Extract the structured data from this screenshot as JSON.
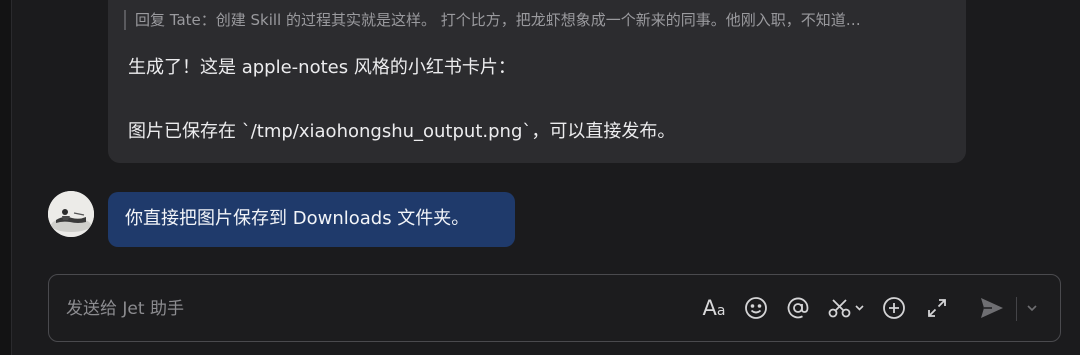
{
  "conversation": {
    "bot_message": {
      "quote": "回复 Tate：创建 Skill 的过程其实就是这样。 打个比方，把龙虾想象成一个新来的同事。他刚入职，不知道…",
      "line1": "生成了！这是 apple-notes 风格的小红书卡片：",
      "line2": "图片已保存在 `/tmp/xiaohongshu_output.png`，可以直接发布。"
    },
    "user_message": {
      "text": "你直接把图片保存到 Downloads 文件夹。"
    }
  },
  "composer": {
    "placeholder": "发送给 Jet 助手",
    "value": "",
    "font_button_label_big": "A",
    "font_button_label_small": "a"
  },
  "icons": {
    "format": "text-format-icon",
    "emoji": "emoji-icon",
    "mention": "at-mention-icon",
    "screenshot": "scissors-icon",
    "add": "plus-circle-icon",
    "expand": "expand-icon",
    "send": "send-icon",
    "more": "chevron-down-icon"
  },
  "colors": {
    "background": "#1b1b1d",
    "bot_bubble": "#2c2c2f",
    "user_bubble": "#1f3a6b",
    "composer_border": "#4a4a4e",
    "text_primary": "#ececee",
    "text_muted": "#9a9a9e"
  }
}
